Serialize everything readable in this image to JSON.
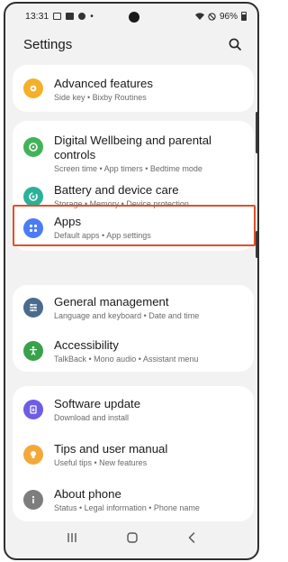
{
  "status_bar": {
    "time": "13:31",
    "battery": "96%"
  },
  "header": {
    "title": "Settings"
  },
  "settings": {
    "advanced": {
      "name": "Advanced features",
      "sub": "Side key  •  Bixby Routines",
      "icon": "gear-star-icon",
      "color": "#f4b02a"
    },
    "wellbeing": {
      "name_line1": "Digital Wellbeing and parental",
      "name_line2": "controls",
      "sub": "Screen time  •  App timers  •  Bedtime mode",
      "icon": "wellbeing-icon",
      "color": "#43b35a"
    },
    "battery": {
      "name": "Battery and device care",
      "sub": "Storage  •  Memory  •  Device protection",
      "icon": "device-care-icon",
      "color": "#2bb19a"
    },
    "apps": {
      "name": "Apps",
      "sub": "Default apps  •  App settings",
      "icon": "apps-grid-icon",
      "color": "#4b7bf5"
    },
    "general": {
      "name": "General management",
      "sub": "Language and keyboard  •  Date and time",
      "icon": "sliders-icon",
      "color": "#4b6b8c"
    },
    "accessibility": {
      "name": "Accessibility",
      "sub": "TalkBack  •  Mono audio  •  Assistant menu",
      "icon": "accessibility-icon",
      "color": "#37a24b"
    },
    "software": {
      "name": "Software update",
      "sub": "Download and install",
      "icon": "update-icon",
      "color": "#6d5ce6"
    },
    "tips": {
      "name": "Tips and user manual",
      "sub": "Useful tips  •  New features",
      "icon": "lightbulb-icon",
      "color": "#f2a93a"
    },
    "about": {
      "name": "About phone",
      "sub": "Status  •  Legal information  •  Phone name",
      "icon": "info-icon",
      "color": "#7d7d7d"
    }
  },
  "colors": {
    "highlight": "#e0502a",
    "background": "#f2f2f2",
    "card": "#ffffff"
  }
}
